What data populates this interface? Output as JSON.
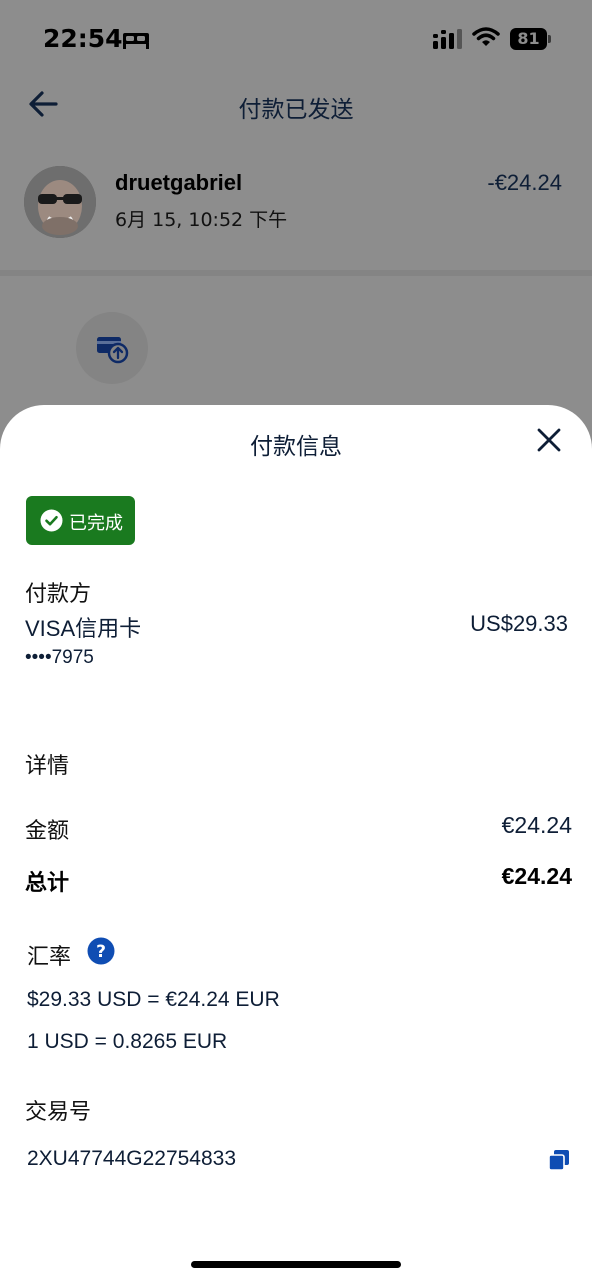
{
  "status_bar": {
    "time": "22:54",
    "battery_level": "81",
    "icons": [
      "bed-icon",
      "signal-icon",
      "wifi-icon",
      "battery-icon"
    ]
  },
  "header": {
    "title": "付款已发送",
    "back_icon": "back-arrow-icon"
  },
  "transaction_summary": {
    "username": "druetgabriel",
    "date": "6月 15, 10:52 下午",
    "amount": "-€24.24"
  },
  "sheet": {
    "title": "付款信息",
    "status_badge": "已完成",
    "payer": {
      "heading": "付款方",
      "card_name": "VISA信用卡",
      "card_amount": "US$29.33",
      "card_number": "••••7975"
    },
    "details": {
      "heading": "详情",
      "amount_label": "金额",
      "amount_value": "€24.24",
      "total_label": "总计",
      "total_value": "€24.24"
    },
    "exchange_rate": {
      "heading": "汇率",
      "line1": "$29.33 USD = €24.24 EUR",
      "line2": "1 USD = 0.8265 EUR"
    },
    "transaction": {
      "heading": "交易号",
      "id": "2XU47744G22754833"
    }
  },
  "colors": {
    "accent_blue": "#0f4db3",
    "success_green": "#1a7a1f",
    "text_navy": "#0e1e36",
    "overlay_gray": "#8d8d8d"
  }
}
